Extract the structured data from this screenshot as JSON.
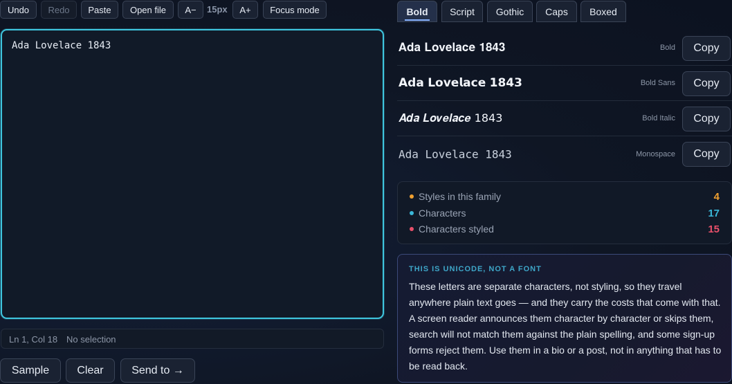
{
  "toolbar": {
    "undo": "Undo",
    "redo": "Redo",
    "paste": "Paste",
    "open_file": "Open file",
    "font_smaller": "A−",
    "font_size": "15px",
    "font_larger": "A+",
    "focus_mode": "Focus mode"
  },
  "editor": {
    "text": "Ada Lovelace 1843"
  },
  "status": {
    "position": "Ln 1, Col 18",
    "selection": "No selection"
  },
  "bottom_actions": {
    "sample": "Sample",
    "clear": "Clear",
    "send_to": "Send to →"
  },
  "tabs": [
    {
      "label": "Bold",
      "active": true
    },
    {
      "label": "Script"
    },
    {
      "label": "Gothic"
    },
    {
      "label": "Caps"
    },
    {
      "label": "Boxed"
    }
  ],
  "styles": [
    {
      "sample": "𝐀𝐝𝐚 𝐋𝐨𝐯𝐞𝐥𝐚𝐜𝐞 𝟏𝟖𝟒𝟑",
      "kind": "Bold",
      "copy": "Copy"
    },
    {
      "sample": "𝗔𝗱𝗮 𝗟𝗼𝘃𝗲𝗹𝗮𝗰𝗲 𝟭𝟴𝟰𝟯",
      "kind": "Bold Sans",
      "copy": "Copy"
    },
    {
      "sample": "𝑨𝒅𝒂 𝑳𝒐𝒗𝒆𝒍𝒂𝒄𝒆 1843",
      "kind": "Bold Italic",
      "copy": "Copy"
    },
    {
      "sample": "𝙰𝚍𝚊 𝙻𝚘𝚟𝚎𝚕𝚊𝚌𝚎 𝟷𝟾𝟺𝟹",
      "kind": "Monospace",
      "copy": "Copy"
    }
  ],
  "stats": [
    {
      "label": "Styles in this family",
      "value": "4",
      "color": "#f0a030"
    },
    {
      "label": "Characters",
      "value": "17",
      "color": "#3ab7d8"
    },
    {
      "label": "Characters styled",
      "value": "15",
      "color": "#e8506a"
    }
  ],
  "note": {
    "title": "THIS IS UNICODE, NOT A FONT",
    "body": "These letters are separate characters, not styling, so they travel anywhere plain text goes — and they carry the costs that come with that. A screen reader announces them character by character or skips them, search will not match them against the plain spelling, and some sign-up forms reject them. Use them in a bio or a post, not in anything that has to be read back."
  }
}
